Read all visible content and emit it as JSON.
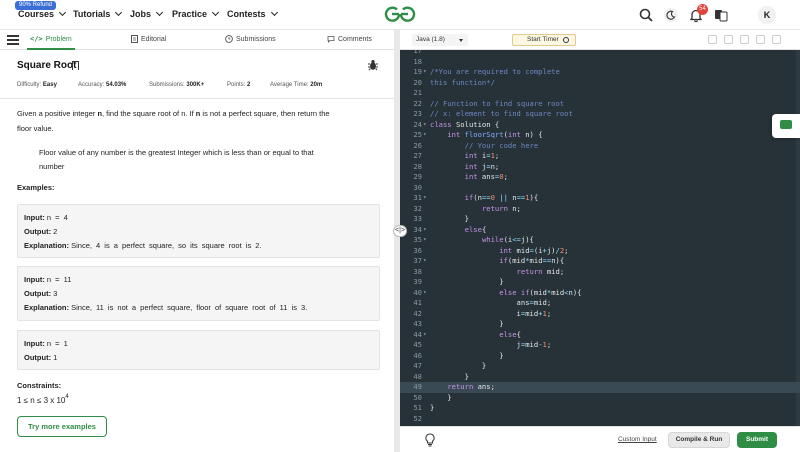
{
  "topnav": {
    "refund_badge": "90% Refund",
    "items": [
      {
        "label": "Courses"
      },
      {
        "label": "Tutorials"
      },
      {
        "label": "Jobs"
      },
      {
        "label": "Practice"
      },
      {
        "label": "Contests"
      }
    ],
    "icons": [
      "search-icon",
      "dark-mode-icon",
      "notification-bell-icon",
      "translate-icon"
    ],
    "notification_count": "54",
    "avatar_initial": "K",
    "brand_color": "#2f8d46"
  },
  "left": {
    "tabs": [
      {
        "label": "Problem",
        "icon": "code-icon",
        "active": true
      },
      {
        "label": "Editorial",
        "icon": "document-icon"
      },
      {
        "label": "Submissions",
        "icon": "clock-icon"
      },
      {
        "label": "Comments",
        "icon": "chat-icon"
      }
    ],
    "title": "Square Root",
    "meta": {
      "difficulty_label": "Difficulty:",
      "difficulty": "Easy",
      "accuracy_label": "Accuracy:",
      "accuracy": "54.03%",
      "submissions_label": "Submissions:",
      "submissions": "300K+",
      "points_label": "Points:",
      "points": "2",
      "avg_time_label": "Average Time:",
      "avg_time": "20m"
    },
    "statement": {
      "p1_a": "Given a positive integer ",
      "p1_n1": "n",
      "p1_b": ", find the square root of n. If ",
      "p1_n2": "n",
      "p1_c": " is not a perfect square, then return the",
      "p1_d": "floor value.",
      "note_1": "Floor value of any number is the greatest Integer which is less than or equal to that",
      "note_2": "number"
    },
    "examples_heading": "Examples:",
    "examples": [
      {
        "input_label": "Input:",
        "input": "n = 4",
        "output_label": "Output:",
        "output": "2",
        "expl_label": "Explanation:",
        "expl": "Since, 4 is a perfect square, so its square root is 2."
      },
      {
        "input_label": "Input:",
        "input": "n = 11",
        "output_label": "Output:",
        "output": "3",
        "expl_label": "Explanation:",
        "expl": "Since, 11 is not a perfect square, floor of square root of 11 is 3."
      },
      {
        "input_label": "Input:",
        "input": "n = 1",
        "output_label": "Output:",
        "output": "1"
      }
    ],
    "constraints_heading": "Constraints:",
    "constraint_base": "1 ≤ n ≤ 3 x 10",
    "constraint_exp": "4",
    "more_examples": "Try more examples"
  },
  "right": {
    "language": "Java (1.8)",
    "timer_label": "Start Timer",
    "custom_input": "Custom Input",
    "compile_run": "Compile & Run",
    "submit": "Submit",
    "current_line": 49,
    "code": [
      {
        "n": "17",
        "t": [
          [
            "pl",
            ""
          ]
        ]
      },
      {
        "n": "18",
        "t": [
          [
            "pl",
            ""
          ]
        ]
      },
      {
        "n": "19",
        "f": true,
        "t": [
          [
            "cm",
            "/*You are required to complete"
          ]
        ]
      },
      {
        "n": "20",
        "t": [
          [
            "cm",
            "this function*/"
          ]
        ]
      },
      {
        "n": "21",
        "t": [
          [
            "pl",
            ""
          ]
        ]
      },
      {
        "n": "22",
        "t": [
          [
            "cm",
            "// Function to find square root"
          ]
        ]
      },
      {
        "n": "23",
        "t": [
          [
            "cm",
            "// x: element to find square root"
          ]
        ]
      },
      {
        "n": "24",
        "f": true,
        "t": [
          [
            "kw",
            "class"
          ],
          [
            "pl",
            " Solution {"
          ]
        ]
      },
      {
        "n": "25",
        "f": true,
        "t": [
          [
            "pl",
            "    "
          ],
          [
            "kw",
            "int"
          ],
          [
            "pl",
            " "
          ],
          [
            "fn",
            "floorSqrt"
          ],
          [
            "pl",
            "("
          ],
          [
            "kw",
            "int"
          ],
          [
            "pl",
            " n) {"
          ]
        ]
      },
      {
        "n": "26",
        "t": [
          [
            "pl",
            "        "
          ],
          [
            "cm",
            "// Your code here"
          ]
        ]
      },
      {
        "n": "27",
        "t": [
          [
            "pl",
            "        "
          ],
          [
            "kw",
            "int"
          ],
          [
            "pl",
            " i"
          ],
          [
            "op",
            "="
          ],
          [
            "num",
            "1"
          ],
          [
            "pl",
            ";"
          ]
        ]
      },
      {
        "n": "28",
        "t": [
          [
            "pl",
            "        "
          ],
          [
            "kw",
            "int"
          ],
          [
            "pl",
            " j"
          ],
          [
            "op",
            "="
          ],
          [
            "pl",
            "n;"
          ]
        ]
      },
      {
        "n": "29",
        "t": [
          [
            "pl",
            "        "
          ],
          [
            "kw",
            "int"
          ],
          [
            "pl",
            " ans"
          ],
          [
            "op",
            "="
          ],
          [
            "num",
            "0"
          ],
          [
            "pl",
            ";"
          ]
        ]
      },
      {
        "n": "30",
        "t": [
          [
            "pl",
            ""
          ]
        ]
      },
      {
        "n": "31",
        "f": true,
        "t": [
          [
            "pl",
            "        "
          ],
          [
            "kw",
            "if"
          ],
          [
            "pl",
            "(n"
          ],
          [
            "op",
            "=="
          ],
          [
            "num",
            "0"
          ],
          [
            "pl",
            " "
          ],
          [
            "op",
            "||"
          ],
          [
            "pl",
            " n"
          ],
          [
            "op",
            "=="
          ],
          [
            "num",
            "1"
          ],
          [
            "pl",
            "){"
          ]
        ]
      },
      {
        "n": "32",
        "t": [
          [
            "pl",
            "            "
          ],
          [
            "kw",
            "return"
          ],
          [
            "pl",
            " n;"
          ]
        ]
      },
      {
        "n": "33",
        "t": [
          [
            "pl",
            "        }"
          ]
        ]
      },
      {
        "n": "34",
        "f": true,
        "t": [
          [
            "pl",
            "        "
          ],
          [
            "kw",
            "else"
          ],
          [
            "pl",
            "{"
          ]
        ]
      },
      {
        "n": "35",
        "f": true,
        "t": [
          [
            "pl",
            "            "
          ],
          [
            "kw",
            "while"
          ],
          [
            "pl",
            "(i"
          ],
          [
            "op",
            "<="
          ],
          [
            "pl",
            "j){"
          ]
        ]
      },
      {
        "n": "36",
        "t": [
          [
            "pl",
            "                "
          ],
          [
            "kw",
            "int"
          ],
          [
            "pl",
            " mid"
          ],
          [
            "op",
            "="
          ],
          [
            "pl",
            "(i"
          ],
          [
            "op",
            "+"
          ],
          [
            "pl",
            "j)"
          ],
          [
            "op",
            "/"
          ],
          [
            "num",
            "2"
          ],
          [
            "pl",
            ";"
          ]
        ]
      },
      {
        "n": "37",
        "f": true,
        "t": [
          [
            "pl",
            "                "
          ],
          [
            "kw",
            "if"
          ],
          [
            "pl",
            "(mid"
          ],
          [
            "op",
            "*"
          ],
          [
            "pl",
            "mid"
          ],
          [
            "op",
            "=="
          ],
          [
            "pl",
            "n){"
          ]
        ]
      },
      {
        "n": "38",
        "t": [
          [
            "pl",
            "                    "
          ],
          [
            "kw",
            "return"
          ],
          [
            "pl",
            " mid;"
          ]
        ]
      },
      {
        "n": "39",
        "t": [
          [
            "pl",
            "                }"
          ]
        ]
      },
      {
        "n": "40",
        "f": true,
        "t": [
          [
            "pl",
            "                "
          ],
          [
            "kw",
            "else if"
          ],
          [
            "pl",
            "(mid"
          ],
          [
            "op",
            "*"
          ],
          [
            "pl",
            "mid"
          ],
          [
            "op",
            "<"
          ],
          [
            "pl",
            "n){"
          ]
        ]
      },
      {
        "n": "41",
        "t": [
          [
            "pl",
            "                    ans"
          ],
          [
            "op",
            "="
          ],
          [
            "pl",
            "mid;"
          ]
        ]
      },
      {
        "n": "42",
        "t": [
          [
            "pl",
            "                    i"
          ],
          [
            "op",
            "="
          ],
          [
            "pl",
            "mid"
          ],
          [
            "op",
            "+"
          ],
          [
            "num",
            "1"
          ],
          [
            "pl",
            ";"
          ]
        ]
      },
      {
        "n": "43",
        "t": [
          [
            "pl",
            "                }"
          ]
        ]
      },
      {
        "n": "44",
        "f": true,
        "t": [
          [
            "pl",
            "                "
          ],
          [
            "kw",
            "else"
          ],
          [
            "pl",
            "{"
          ]
        ]
      },
      {
        "n": "45",
        "t": [
          [
            "pl",
            "                    j"
          ],
          [
            "op",
            "="
          ],
          [
            "pl",
            "mid"
          ],
          [
            "op",
            "-"
          ],
          [
            "num",
            "1"
          ],
          [
            "pl",
            ";"
          ]
        ]
      },
      {
        "n": "46",
        "t": [
          [
            "pl",
            "                }"
          ]
        ]
      },
      {
        "n": "47",
        "t": [
          [
            "pl",
            "            }"
          ]
        ]
      },
      {
        "n": "48",
        "t": [
          [
            "pl",
            "        }"
          ]
        ]
      },
      {
        "n": "49",
        "t": [
          [
            "pl",
            "    "
          ],
          [
            "kw",
            "return"
          ],
          [
            "pl",
            " ans;"
          ]
        ]
      },
      {
        "n": "50",
        "t": [
          [
            "pl",
            "    }"
          ]
        ]
      },
      {
        "n": "51",
        "t": [
          [
            "pl",
            "}"
          ]
        ]
      },
      {
        "n": "52",
        "t": [
          [
            "pl",
            ""
          ]
        ]
      }
    ]
  }
}
